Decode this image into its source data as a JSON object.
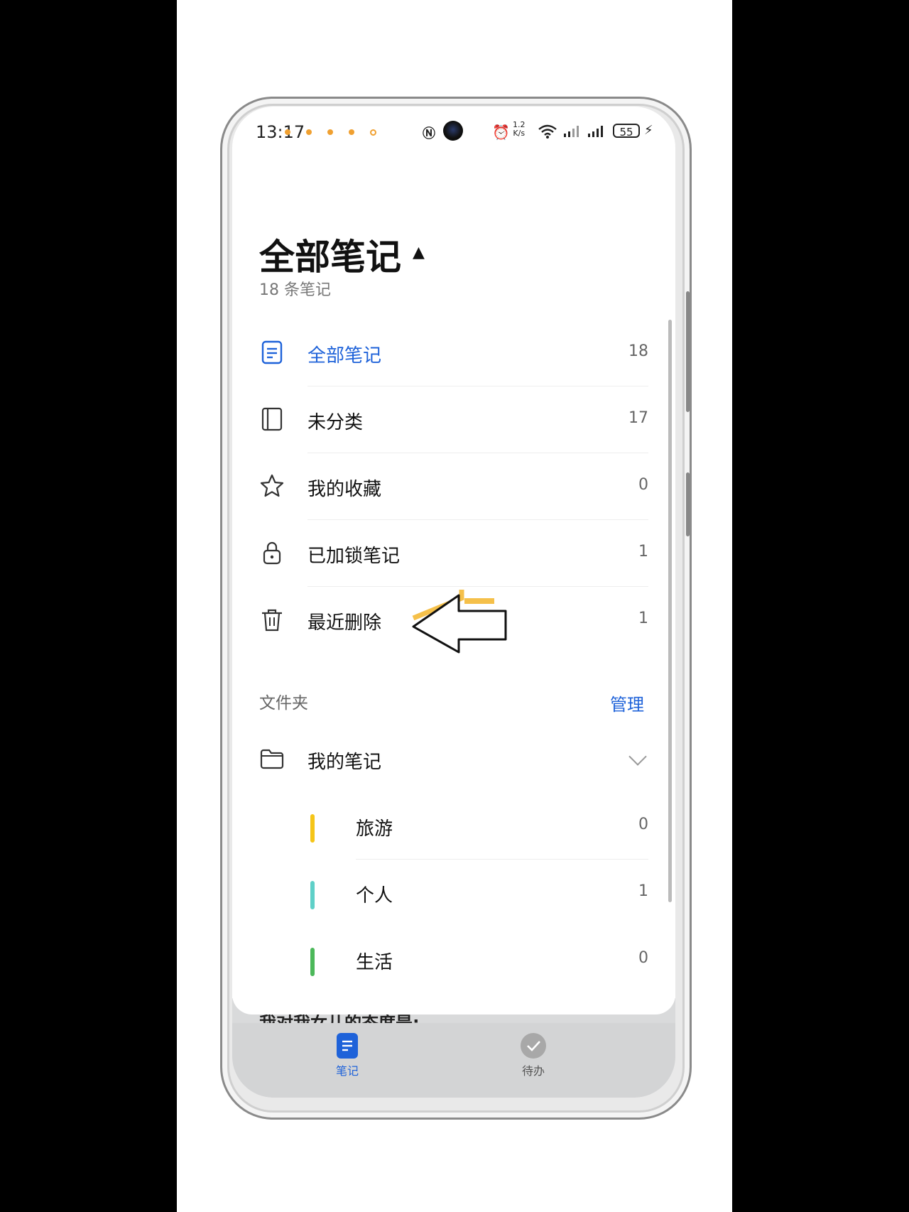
{
  "status_bar": {
    "time": "13:17",
    "network_speed": "1.2\nK/s",
    "battery": "55"
  },
  "header": {
    "title": "全部笔记",
    "subtitle": "18 条笔记"
  },
  "categories": [
    {
      "label": "全部笔记",
      "count": "18",
      "icon": "note-icon",
      "active": true
    },
    {
      "label": "未分类",
      "count": "17",
      "icon": "notebook-icon"
    },
    {
      "label": "我的收藏",
      "count": "0",
      "icon": "star-icon"
    },
    {
      "label": "已加锁笔记",
      "count": "1",
      "icon": "lock-icon"
    },
    {
      "label": "最近删除",
      "count": "1",
      "icon": "trash-icon"
    }
  ],
  "folders": {
    "heading": "文件夹",
    "manage_label": "管理",
    "group": {
      "label": "我的笔记",
      "icon": "folder-icon"
    },
    "items": [
      {
        "label": "旅游",
        "count": "0",
        "color": "#f5c518"
      },
      {
        "label": "个人",
        "count": "1",
        "color": "#5fd0c8"
      },
      {
        "label": "生活",
        "count": "0",
        "color": "#4cb85a"
      }
    ]
  },
  "peek_text": "我对我女儿的态度是:",
  "tabs": [
    {
      "label": "笔记",
      "icon": "notes-tab-icon",
      "active": true
    },
    {
      "label": "待办",
      "icon": "todo-check-icon"
    }
  ],
  "colors": {
    "accent": "#1e62d9",
    "arrow_highlight": "#f5c04a"
  }
}
